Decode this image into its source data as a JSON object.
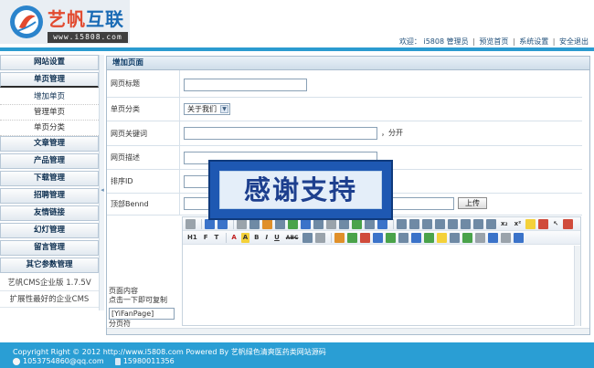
{
  "header": {
    "logo_text_1": "艺帆",
    "logo_text_2": "互联",
    "logo_url": "www.i5808.com",
    "welcome": "欢迎：",
    "user": "i5808 管理员",
    "links": [
      "预览首页",
      "系统设置",
      "安全退出"
    ]
  },
  "sidebar": {
    "menus": [
      {
        "label": "网站设置"
      },
      {
        "label": "单页管理"
      },
      {
        "label": "文章管理"
      },
      {
        "label": "产品管理"
      },
      {
        "label": "下载管理"
      },
      {
        "label": "招聘管理"
      },
      {
        "label": "友情链接"
      },
      {
        "label": "幻灯管理"
      },
      {
        "label": "留言管理"
      },
      {
        "label": "其它参数管理"
      }
    ],
    "sub_items": [
      "增加单页",
      "管理单页",
      "单页分类"
    ],
    "info_items": [
      "艺帆CMS企业版 1.7.5V",
      "扩展性最好的企业CMS"
    ]
  },
  "main": {
    "title": "增加页面",
    "fields": {
      "page_title": {
        "label": "网页标题",
        "value": ""
      },
      "category": {
        "label": "单页分类",
        "selected": "关于我们"
      },
      "keywords": {
        "label": "网页关键词",
        "value": "",
        "hint": "，分开"
      },
      "description": {
        "label": "网页描述",
        "value": ""
      },
      "order": {
        "label": "排序ID",
        "value": ""
      },
      "banner": {
        "label": "顶部Bennd",
        "value": "",
        "button": "上传"
      }
    },
    "content": {
      "label_1": "页面内容",
      "label_2": "点击一下即可复制",
      "tag": "[YiFanPage]",
      "label_3": "分页符"
    },
    "editor_toolbar": {
      "row1": [
        "source-icon",
        "undo-icon",
        "redo-icon",
        "cut-icon",
        "copy-icon",
        "paste-icon",
        "paste-text-icon",
        "find-icon",
        "replace-icon",
        "select-all-icon",
        "remove-format-icon",
        "new-page-icon",
        "preview-icon",
        "print-icon",
        "template-icon",
        "align-left-icon",
        "align-center-icon",
        "align-right-icon",
        "justify-icon",
        "ordered-list-icon",
        "unordered-list-icon",
        "indent-icon",
        "outdent-icon",
        "subscript-icon",
        "superscript-icon",
        "format-painter-icon",
        "clear-icon",
        "select-icon",
        "fullscreen-icon"
      ],
      "row2_text": {
        "heading": "H1",
        "font": "F",
        "size": "T",
        "fore": "A",
        "back": "A",
        "bold": "B",
        "italic": "I",
        "underline": "U",
        "strike": "ABC"
      }
    }
  },
  "overlay": {
    "text": "感谢支持"
  },
  "footer": {
    "copyright": "Copyright Right © 2012 http://www.i5808.com Powered By 艺帆绿色清爽医药类网站源码",
    "email": "1053754860@qq.com",
    "phone": "15980011356"
  },
  "colors": {
    "header_bar": "#2b9bd0",
    "footer": "#2a9ed4",
    "overlay": "#1e58b2",
    "link": "#1f4f7a"
  }
}
